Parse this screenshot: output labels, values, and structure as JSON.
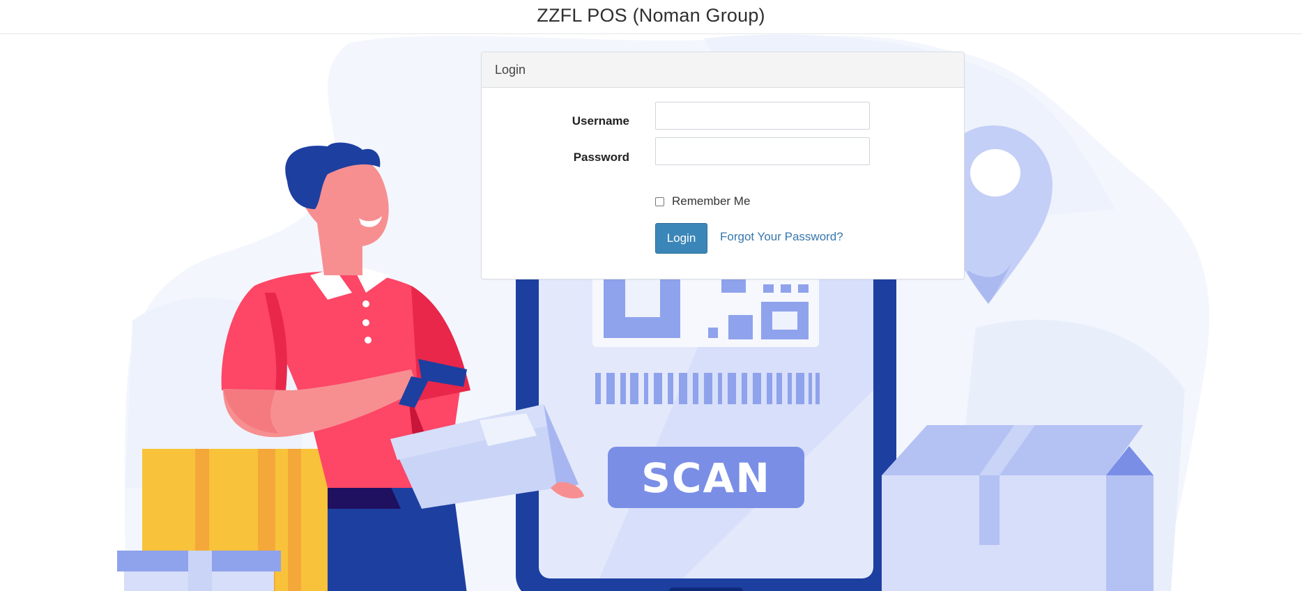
{
  "app": {
    "title": "ZZFL POS (Noman Group)"
  },
  "login_panel": {
    "header": "Login",
    "username_label": "Username",
    "username_value": "",
    "password_label": "Password",
    "password_value": "",
    "remember_label": "Remember Me",
    "remember_checked": false,
    "login_button": "Login",
    "forgot_link": "Forgot Your Password?"
  },
  "illustration": {
    "scan_text": "SCAN"
  },
  "colors": {
    "primary_button": "#3b86b8",
    "link": "#3777ad",
    "blob_background": "#f3f6fd",
    "phone_frame": "#1d3fa0",
    "shirt": "#fe4666",
    "box_yellow": "#f8c33a",
    "box_lavender": "#d6def9"
  }
}
